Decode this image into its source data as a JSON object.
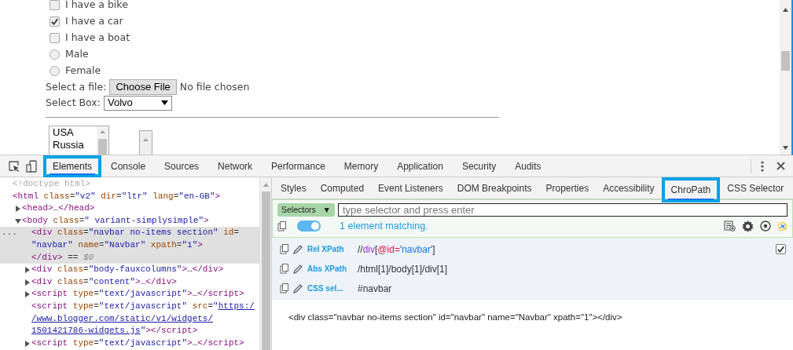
{
  "page": {
    "checkboxes": [
      {
        "label": "I have a bike",
        "checked": false
      },
      {
        "label": "I have a car",
        "checked": true
      },
      {
        "label": "I have a boat",
        "checked": false
      }
    ],
    "radios": [
      {
        "label": "Male",
        "selected": false
      },
      {
        "label": "Female",
        "selected": false
      }
    ],
    "file": {
      "label": "Select a file:",
      "button": "Choose File",
      "status": "No file chosen"
    },
    "select": {
      "label": "Select Box:",
      "value": "Volvo"
    },
    "listbox": {
      "options": [
        "USA",
        "Russia"
      ]
    }
  },
  "devtools": {
    "tabs": [
      {
        "label": "Elements",
        "selected": true,
        "highlighted": true
      },
      {
        "label": "Console",
        "selected": false,
        "highlighted": false
      },
      {
        "label": "Sources",
        "selected": false,
        "highlighted": false
      },
      {
        "label": "Network",
        "selected": false,
        "highlighted": false
      },
      {
        "label": "Performance",
        "selected": false,
        "highlighted": false
      },
      {
        "label": "Memory",
        "selected": false,
        "highlighted": false
      },
      {
        "label": "Application",
        "selected": false,
        "highlighted": false
      },
      {
        "label": "Security",
        "selected": false,
        "highlighted": false
      },
      {
        "label": "Audits",
        "selected": false,
        "highlighted": false
      }
    ],
    "dom_tree": [
      {
        "lines": [
          [
            {
              "kind": "comment",
              "text": "<!doctype html>"
            }
          ]
        ],
        "selected": false
      },
      {
        "lines": [
          [
            {
              "kind": "tag",
              "text": "<html"
            },
            {
              "kind": "attr",
              "text": " class"
            },
            {
              "kind": "plain",
              "text": "="
            },
            {
              "kind": "val",
              "text": "\"v2\""
            },
            {
              "kind": "attr",
              "text": " dir"
            },
            {
              "kind": "plain",
              "text": "="
            },
            {
              "kind": "val",
              "text": "\"ltr\""
            },
            {
              "kind": "attr",
              "text": " lang"
            },
            {
              "kind": "plain",
              "text": "="
            },
            {
              "kind": "val",
              "text": "\"en-GB\""
            },
            {
              "kind": "tag",
              "text": ">"
            }
          ]
        ],
        "selected": false,
        "children": [
          {
            "lines": [
              [
                {
                  "kind": "tag",
                  "text": "<head>"
                },
                {
                  "kind": "plain",
                  "text": "…"
                },
                {
                  "kind": "tag",
                  "text": "</head>"
                }
              ]
            ],
            "expanded": false,
            "selected": false
          },
          {
            "lines": [
              [
                {
                  "kind": "tag",
                  "text": "<body"
                },
                {
                  "kind": "attr",
                  "text": " class"
                },
                {
                  "kind": "plain",
                  "text": "="
                },
                {
                  "kind": "val",
                  "text": "\" variant-simplysimple\""
                },
                {
                  "kind": "tag",
                  "text": ">"
                }
              ]
            ],
            "expanded": true,
            "selected": false,
            "children": [
              {
                "lines": [
                  [
                    {
                      "kind": "tag",
                      "text": "<div"
                    },
                    {
                      "kind": "attr",
                      "text": " class"
                    },
                    {
                      "kind": "plain",
                      "text": "="
                    },
                    {
                      "kind": "val",
                      "text": "\"navbar no-items section\""
                    },
                    {
                      "kind": "attr",
                      "text": " id"
                    },
                    {
                      "kind": "plain",
                      "text": "="
                    }
                  ],
                  [
                    {
                      "kind": "val",
                      "text": "\"navbar\""
                    },
                    {
                      "kind": "attr",
                      "text": " name"
                    },
                    {
                      "kind": "plain",
                      "text": "="
                    },
                    {
                      "kind": "val",
                      "text": "\"Navbar\""
                    },
                    {
                      "kind": "attr",
                      "text": " xpath"
                    },
                    {
                      "kind": "plain",
                      "text": "="
                    },
                    {
                      "kind": "val",
                      "text": "\"1\""
                    },
                    {
                      "kind": "tag",
                      "text": ">"
                    }
                  ],
                  [
                    {
                      "kind": "tag",
                      "text": "</div>"
                    },
                    {
                      "kind": "plain",
                      "text": " == "
                    },
                    {
                      "kind": "var",
                      "text": "$0"
                    }
                  ]
                ],
                "selected": true,
                "gutter": "..."
              },
              {
                "lines": [
                  [
                    {
                      "kind": "tag",
                      "text": "<div"
                    },
                    {
                      "kind": "attr",
                      "text": " class"
                    },
                    {
                      "kind": "plain",
                      "text": "="
                    },
                    {
                      "kind": "val",
                      "text": "\"body-fauxcolumns\""
                    },
                    {
                      "kind": "tag",
                      "text": ">"
                    },
                    {
                      "kind": "plain",
                      "text": "…"
                    },
                    {
                      "kind": "tag",
                      "text": "</div>"
                    }
                  ]
                ],
                "expanded": false,
                "selected": false
              },
              {
                "lines": [
                  [
                    {
                      "kind": "tag",
                      "text": "<div"
                    },
                    {
                      "kind": "attr",
                      "text": " class"
                    },
                    {
                      "kind": "plain",
                      "text": "="
                    },
                    {
                      "kind": "val",
                      "text": "\"content\""
                    },
                    {
                      "kind": "tag",
                      "text": ">"
                    },
                    {
                      "kind": "plain",
                      "text": "…"
                    },
                    {
                      "kind": "tag",
                      "text": "</div>"
                    }
                  ]
                ],
                "expanded": false,
                "selected": false
              },
              {
                "lines": [
                  [
                    {
                      "kind": "tag",
                      "text": "<script"
                    },
                    {
                      "kind": "attr",
                      "text": " type"
                    },
                    {
                      "kind": "plain",
                      "text": "="
                    },
                    {
                      "kind": "val",
                      "text": "\"text/javascript\""
                    },
                    {
                      "kind": "tag",
                      "text": ">"
                    },
                    {
                      "kind": "plain",
                      "text": "…"
                    },
                    {
                      "kind": "tag",
                      "text": "</script>"
                    }
                  ]
                ],
                "expanded": false,
                "selected": false
              },
              {
                "lines": [
                  [
                    {
                      "kind": "tag",
                      "text": "<script"
                    },
                    {
                      "kind": "attr",
                      "text": " type"
                    },
                    {
                      "kind": "plain",
                      "text": "="
                    },
                    {
                      "kind": "val",
                      "text": "\"text/javascript\""
                    },
                    {
                      "kind": "attr",
                      "text": " src"
                    },
                    {
                      "kind": "plain",
                      "text": "="
                    },
                    {
                      "kind": "val",
                      "text": "\""
                    },
                    {
                      "kind": "link",
                      "text": "https:/"
                    }
                  ],
                  [
                    {
                      "kind": "link",
                      "text": "/www.blogger.com/static/v1/widgets/"
                    }
                  ],
                  [
                    {
                      "kind": "link",
                      "text": "1501421786-widgets.js"
                    },
                    {
                      "kind": "val",
                      "text": "\""
                    },
                    {
                      "kind": "tag",
                      "text": "></script>"
                    }
                  ]
                ],
                "selected": false
              },
              {
                "lines": [
                  [
                    {
                      "kind": "tag",
                      "text": "<script"
                    },
                    {
                      "kind": "attr",
                      "text": " type"
                    },
                    {
                      "kind": "plain",
                      "text": "="
                    },
                    {
                      "kind": "val",
                      "text": "\"text/javascript\""
                    },
                    {
                      "kind": "tag",
                      "text": ">"
                    },
                    {
                      "kind": "plain",
                      "text": "…"
                    },
                    {
                      "kind": "tag",
                      "text": "</script>"
                    }
                  ]
                ],
                "expanded": false,
                "selected": false
              }
            ]
          }
        ]
      }
    ],
    "sidebar_tabs": [
      {
        "label": "Styles",
        "selected": false,
        "highlighted": false
      },
      {
        "label": "Computed",
        "selected": false,
        "highlighted": false
      },
      {
        "label": "Event Listeners",
        "selected": false,
        "highlighted": false
      },
      {
        "label": "DOM Breakpoints",
        "selected": false,
        "highlighted": false
      },
      {
        "label": "Properties",
        "selected": false,
        "highlighted": false
      },
      {
        "label": "Accessibility",
        "selected": false,
        "highlighted": false
      },
      {
        "label": "ChroPath",
        "selected": true,
        "highlighted": true
      },
      {
        "label": "CSS Selector",
        "selected": false,
        "highlighted": false
      }
    ],
    "chropath": {
      "mode": "Selectors",
      "mode_caret": "▼",
      "placeholder": "type selector and press enter",
      "toggle_on": true,
      "match_count": "1 element matching.",
      "results": [
        {
          "label": "Rel XPath",
          "value": [
            {
              "kind": "plain",
              "text": "//"
            },
            {
              "kind": "tag",
              "text": "div"
            },
            {
              "kind": "plain",
              "text": "["
            },
            {
              "kind": "attr",
              "text": "@id="
            },
            {
              "kind": "plain",
              "text": "'"
            },
            {
              "kind": "val",
              "text": "navbar"
            },
            {
              "kind": "plain",
              "text": "']"
            }
          ],
          "checked": true
        },
        {
          "label": "Abs XPath",
          "value": [
            {
              "kind": "plain",
              "text": "/html[1]/body[1]/div[1]"
            }
          ]
        },
        {
          "label": "CSS sel...",
          "value": [
            {
              "kind": "plain",
              "text": "#navbar"
            }
          ]
        }
      ],
      "output": "<div class=\"navbar no-items section\" id=\"navbar\" name=\"Navbar\" xpath=\"1\"></div>"
    }
  }
}
